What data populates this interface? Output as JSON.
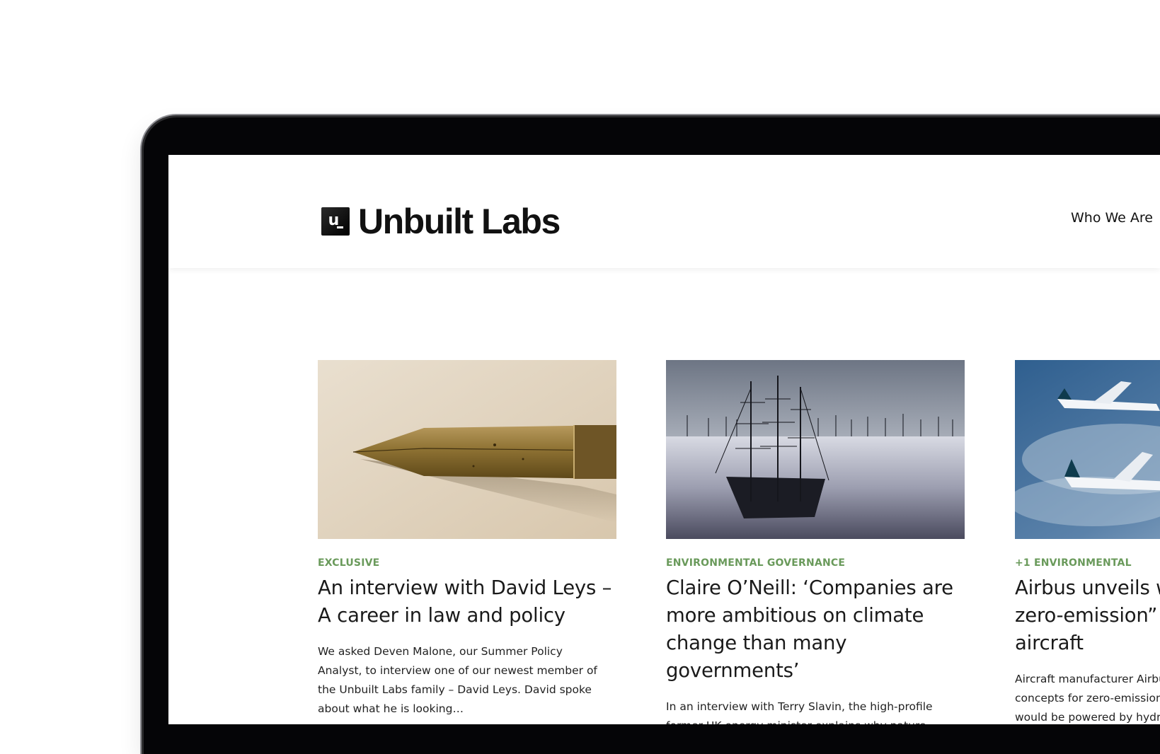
{
  "header": {
    "logo_text": "Unbuilt Labs",
    "nav": {
      "who_we_are": "Who We Are"
    }
  },
  "colors": {
    "tag_green": "#6a9a5b",
    "frame_black": "#050507"
  },
  "cards": [
    {
      "image_icon": "fountain-pen-nib-photo",
      "tag": "EXCLUSIVE",
      "title": "An interview with David Leys – A career in law and policy",
      "excerpt": "We asked Deven Malone, our Summer Policy Analyst, to interview one of our newest member of the Unbuilt Labs family – David Leys. David spoke about what he is looking…"
    },
    {
      "image_icon": "tall-ship-wind-farm-photo",
      "tag": "ENVIRONMENTAL GOVERNANCE",
      "title": "Claire O’Neill: ‘Companies are more ambitious on climate change than many governments’",
      "excerpt": "In an interview with Terry Slavin, the high-profile former UK energy minister explains why nature-"
    },
    {
      "image_icon": "aircraft-over-sea-photo",
      "tag": "+1 ENVIRONMENTAL",
      "title": "Airbus unveils world’s “first zero-emission” commercial aircraft",
      "excerpt": "Aircraft manufacturer Airbus has unveiled three concepts for zero-emission commercial aircraft that would be powered by hydrogen"
    }
  ]
}
